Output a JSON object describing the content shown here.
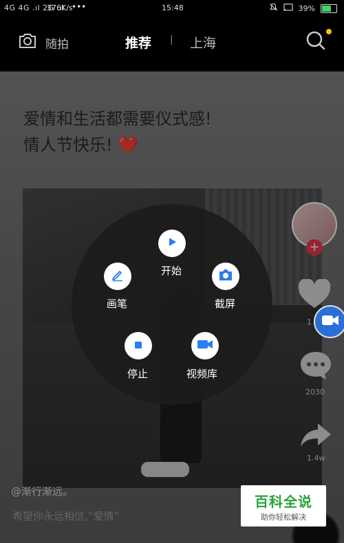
{
  "status_bar": {
    "network": "4G 4G .ıl 2G .ıl",
    "speed": "376K/s",
    "dots": "•••",
    "time": "15:48",
    "battery": "39%"
  },
  "top_nav": {
    "shoot_label": "随拍",
    "recommend_tab": "推荐",
    "separator": "|",
    "city_tab": "上海"
  },
  "video": {
    "caption_line1": "爱情和生活都需要仪式感!",
    "caption_line2": "情人节快乐!",
    "caption_emoji": "❤️",
    "author": "@渐行渐远。",
    "description": "希望你永远相信,“爱情”"
  },
  "sidebar": {
    "follow_symbol": "+",
    "like_count": "1",
    "comment_count": "2030",
    "share_count": "1.4w"
  },
  "record_menu": {
    "start_label": "开始",
    "pen_label": "画笔",
    "screenshot_label": "截屏",
    "stop_label": "停止",
    "video_library_label": "视频库"
  },
  "watermark": {
    "title": "百科全说",
    "subtitle": "助你轻松解决"
  },
  "colors": {
    "accent_blue": "#2a7ef0",
    "follow_red": "#e63950",
    "notification_yellow": "#f5c400",
    "watermark_green": "#2aa33b"
  }
}
